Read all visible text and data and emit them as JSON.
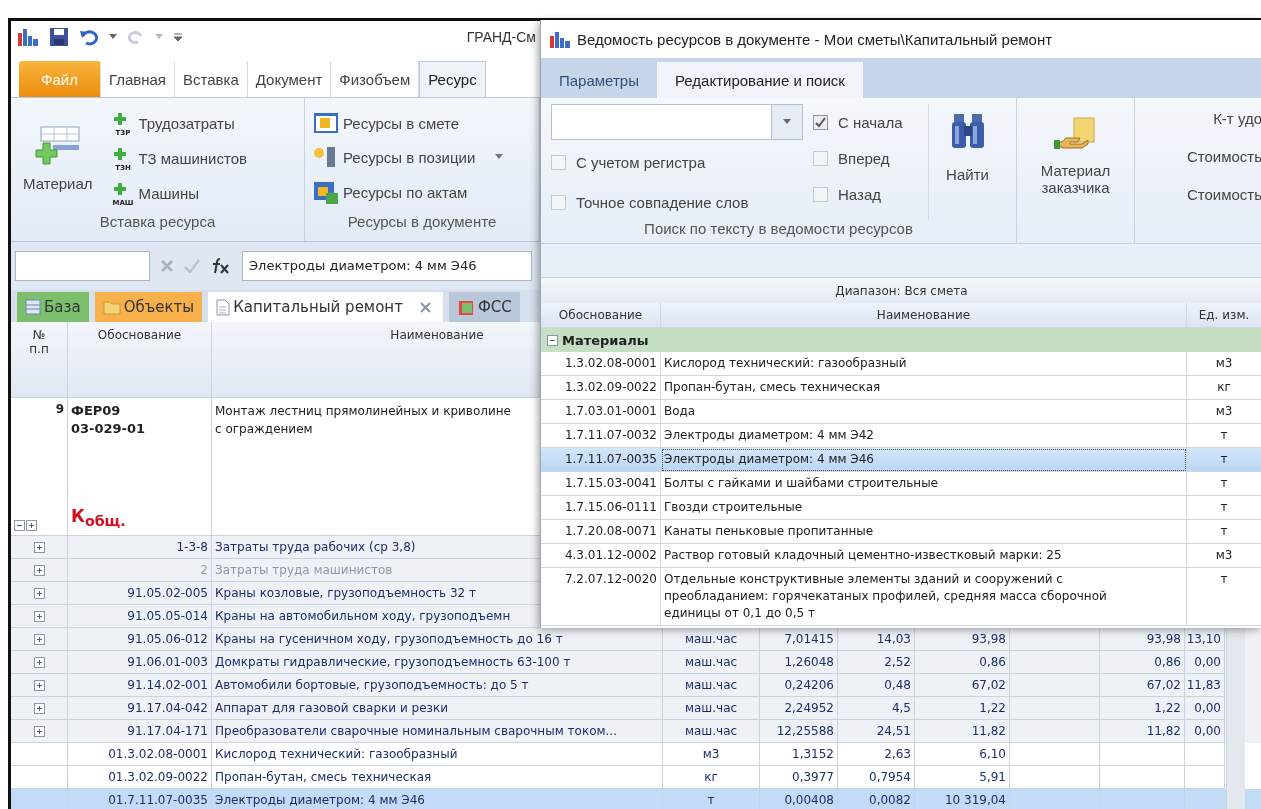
{
  "main_window": {
    "title": "ГРАНД-См",
    "ribbon_tabs": [
      {
        "label": "Файл",
        "kind": "file",
        "selected": false
      },
      {
        "label": "Главная",
        "kind": "tab",
        "selected": false
      },
      {
        "label": "Вставка",
        "kind": "tab",
        "selected": false
      },
      {
        "label": "Документ",
        "kind": "tab",
        "selected": false
      },
      {
        "label": "Физобъем",
        "kind": "tab",
        "selected": false
      },
      {
        "label": "Ресурс",
        "kind": "tab",
        "selected": true
      }
    ],
    "ribbon_groups": [
      {
        "label": "Вставка ресурса",
        "large_button": "Материал",
        "items": [
          {
            "label": "Трудозатраты",
            "kind": "add",
            "badge": "ТЗР"
          },
          {
            "label": "ТЗ машинистов",
            "kind": "add",
            "badge": "ТЗН"
          },
          {
            "label": "Машины",
            "kind": "add",
            "badge": "МАШ"
          }
        ]
      },
      {
        "label": "Ресурсы в документе",
        "items": [
          {
            "label": "Ресурсы в смете",
            "kind": "sheet"
          },
          {
            "label": "Ресурсы в позиции",
            "kind": "position",
            "dropdown": true
          },
          {
            "label": "Ресурсы по актам",
            "kind": "acts"
          }
        ]
      }
    ],
    "formula_bar": {
      "value": "Электроды диаметром: 4 мм Э46"
    },
    "document_tabs": [
      {
        "label": "База",
        "kind": "base",
        "selected": false,
        "closable": false
      },
      {
        "label": "Объекты",
        "kind": "objects",
        "selected": false,
        "closable": false
      },
      {
        "label": "Капитальный ремонт",
        "kind": "document",
        "selected": true,
        "closable": true
      },
      {
        "label": "ФСС",
        "kind": "reference",
        "selected": false,
        "closable": false
      }
    ],
    "grid": {
      "columns": [
        "№ п.п",
        "Обоснование",
        "Наименование"
      ],
      "position": {
        "number": "9",
        "code_lines": [
          "ФЕР09",
          "03-029-01"
        ],
        "name_lines": [
          "Монтаж лестниц прямолинейных и криволине",
          "с ограждением"
        ],
        "coefficient": "К$_{общ.}$"
      },
      "rows": [
        {
          "expandable": true,
          "dimmed": false,
          "selected": false,
          "code": "1-3-8",
          "name": "Затраты труда рабочих (ср 3,8)"
        },
        {
          "expandable": true,
          "dimmed": true,
          "selected": false,
          "code": "2",
          "name": "Затраты труда машинистов"
        },
        {
          "expandable": true,
          "dimmed": false,
          "selected": false,
          "code": "91.05.02-005",
          "name": "Краны козловые, грузоподъемность 32 т"
        },
        {
          "expandable": true,
          "dimmed": false,
          "selected": false,
          "code": "91.05.05-014",
          "name": "Краны на автомобильном ходу, грузоподъемн"
        },
        {
          "expandable": true,
          "dimmed": false,
          "selected": false,
          "code": "91.05.06-012",
          "name": "Краны на гусеничном ходу, грузоподъемность до 16 т",
          "column_4": "маш.час",
          "column_5": "7,01415",
          "column_6": "14,03",
          "column_7": "93,98",
          "column_9": "93,98",
          "column_10": "13,10"
        },
        {
          "expandable": true,
          "dimmed": false,
          "selected": false,
          "code": "91.06.01-003",
          "name": "Домкраты гидравлические, грузоподъемность 63-100 т",
          "column_4": "маш.час",
          "column_5": "1,26048",
          "column_6": "2,52",
          "column_7": "0,86",
          "column_9": "0,86",
          "column_10": "0,00"
        },
        {
          "expandable": true,
          "dimmed": false,
          "selected": false,
          "code": "91.14.02-001",
          "name": "Автомобили бортовые, грузоподъемность: до 5 т",
          "column_4": "маш.час",
          "column_5": "0,24206",
          "column_6": "0,48",
          "column_7": "67,02",
          "column_9": "67,02",
          "column_10": "11,83"
        },
        {
          "expandable": true,
          "dimmed": false,
          "selected": false,
          "code": "91.17.04-042",
          "name": "Аппарат для газовой сварки и резки",
          "column_4": "маш.час",
          "column_5": "2,24952",
          "column_6": "4,5",
          "column_7": "1,22",
          "column_9": "1,22",
          "column_10": "0,00"
        },
        {
          "expandable": true,
          "dimmed": false,
          "selected": false,
          "code": "91.17.04-171",
          "name": "Преобразователи сварочные номинальным сварочным током...",
          "column_4": "маш.час",
          "column_5": "12,25588",
          "column_6": "24,51",
          "column_7": "11,82",
          "column_9": "11,82",
          "column_10": "0,00"
        },
        {
          "expandable": false,
          "dimmed": false,
          "selected": false,
          "code": "01.3.02.08-0001",
          "name": "Кислород технический: газообразный",
          "column_4": "м3",
          "column_5": "1,3152",
          "column_6": "2,63",
          "column_7": "6,10"
        },
        {
          "expandable": false,
          "dimmed": false,
          "selected": false,
          "code": "01.3.02.09-0022",
          "name": "Пропан-бутан, смесь техническая",
          "column_4": "кг",
          "column_5": "0,3977",
          "column_6": "0,7954",
          "column_7": "5,91"
        },
        {
          "expandable": false,
          "dimmed": false,
          "selected": true,
          "code": "01.7.11.07-0035",
          "name": "Электроды диаметром: 4 мм Э46",
          "column_4": "т",
          "column_5": "0,00408",
          "column_6": "0,0082",
          "column_7": "10 319,04"
        }
      ]
    }
  },
  "dialog": {
    "title": "Ведомость ресурсов в документе - Мои сметы\\Капитальный ремонт",
    "tabs": [
      {
        "label": "Параметры",
        "selected": false
      },
      {
        "label": "Редактирование и поиск",
        "selected": true
      }
    ],
    "search": {
      "options_left": [
        {
          "label": "С учетом регистра",
          "checked": false
        },
        {
          "label": "Точное совпадение слов",
          "checked": false
        }
      ],
      "options_right": [
        {
          "label": "С начала",
          "checked": true
        },
        {
          "label": "Вперед",
          "checked": false
        },
        {
          "label": "Назад",
          "checked": false
        }
      ],
      "find_button": "Найти",
      "group_label": "Поиск по тексту в ведомости ресурсов"
    },
    "customer_material_button": "Материал заказчика",
    "cut_labels": [
      "К-т удо",
      "Стоимость",
      "Стоимость"
    ],
    "range_label": "Диапазон: Вся смета",
    "columns": [
      "Обоснование",
      "Наименование",
      "Ед. изм."
    ],
    "group": {
      "label": "Материалы",
      "expanded": true
    },
    "rows": [
      {
        "code": "1.3.02.08-0001",
        "name": "Кислород технический: газообразный",
        "unit": "м3",
        "selected": false
      },
      {
        "code": "1.3.02.09-0022",
        "name": "Пропан-бутан, смесь техническая",
        "unit": "кг",
        "selected": false
      },
      {
        "code": "1.7.03.01-0001",
        "name": "Вода",
        "unit": "м3",
        "selected": false
      },
      {
        "code": "1.7.11.07-0032",
        "name": "Электроды диаметром: 4 мм Э42",
        "unit": "т",
        "selected": false
      },
      {
        "code": "1.7.11.07-0035",
        "name": "Электроды диаметром: 4 мм Э46",
        "unit": "т",
        "selected": true
      },
      {
        "code": "1.7.15.03-0041",
        "name": "Болты с гайками и шайбами строительные",
        "unit": "т",
        "selected": false
      },
      {
        "code": "1.7.15.06-0111",
        "name": "Гвозди строительные",
        "unit": "т",
        "selected": false
      },
      {
        "code": "1.7.20.08-0071",
        "name": "Канаты пеньковые пропитанные",
        "unit": "т",
        "selected": false
      },
      {
        "code": "4.3.01.12-0002",
        "name": "Раствор готовый кладочный цементно-известковый марки: 25",
        "unit": "м3",
        "selected": false
      },
      {
        "code": "7.2.07.12-0020",
        "name": "Отдельные конструктивные элементы зданий и сооружений с преобладанием: горячекатаных профилей, средняя масса сборочной единицы от 0,1 до 0,5 т",
        "unit": "т",
        "selected": false
      }
    ]
  }
}
